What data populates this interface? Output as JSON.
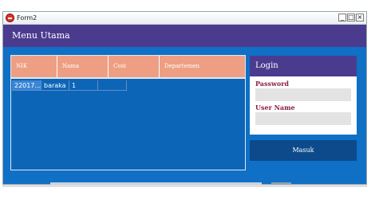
{
  "window": {
    "title": "Form2",
    "min_label": "_",
    "max_label": "□",
    "close_label": "×"
  },
  "header": {
    "title": "Menu Utama"
  },
  "grid": {
    "columns": [
      "NIK",
      "Nama",
      "Cost",
      "Departemen"
    ],
    "rows": [
      {
        "nik": "22017...",
        "nama": "baraka",
        "cost": "1",
        "departemen": ""
      }
    ]
  },
  "login": {
    "title": "Login",
    "password_label": "Password",
    "password_value": "",
    "username_label": "User Name",
    "username_value": "",
    "submit_label": "Masuk"
  },
  "colors": {
    "accent_purple": "#4b3b8f",
    "form_blue": "#0f70c6",
    "header_salmon": "#ee9f83",
    "label_maroon": "#8a1f3e",
    "button_navy": "#0c4a8c"
  }
}
